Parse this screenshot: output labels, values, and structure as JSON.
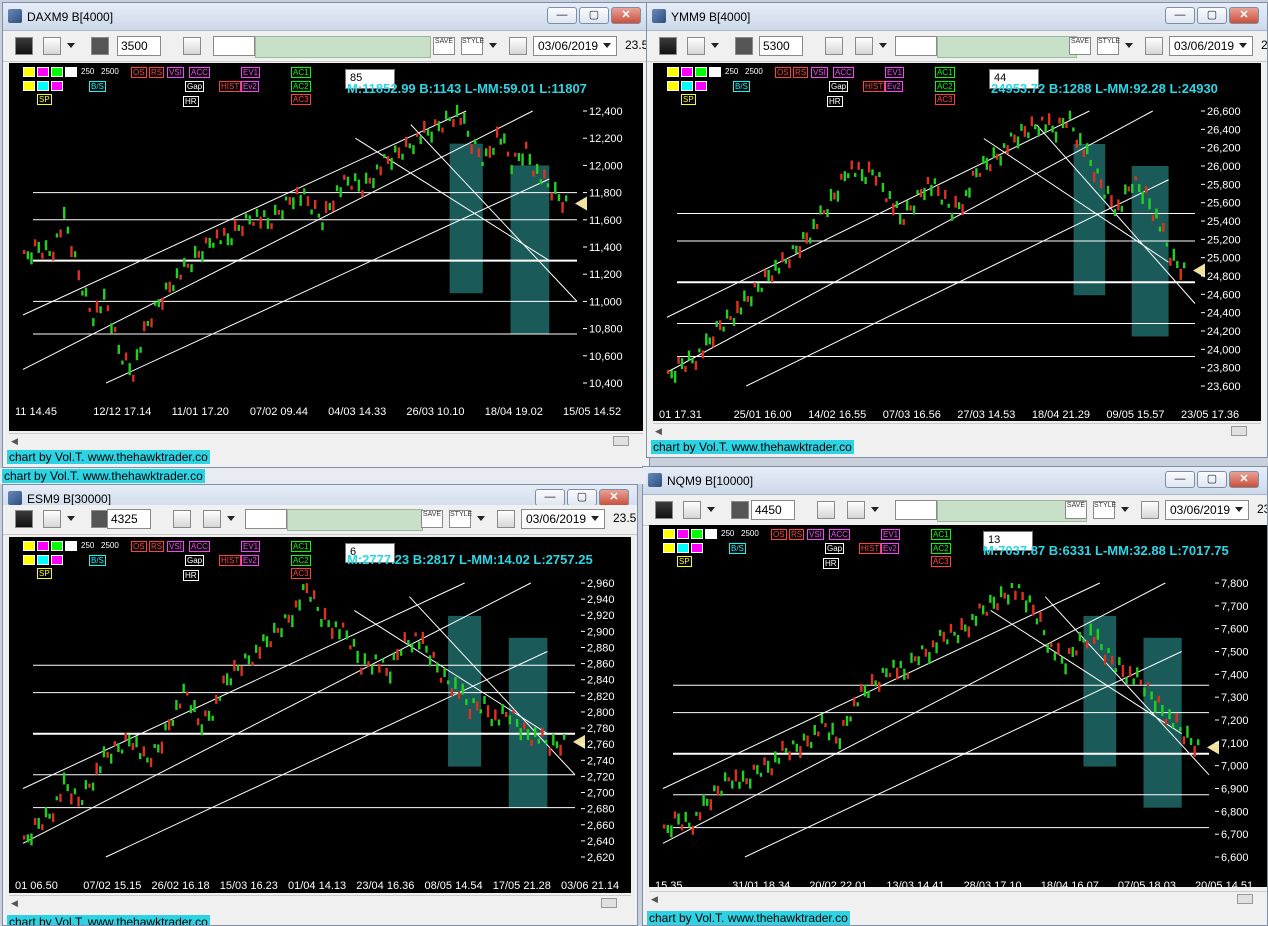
{
  "common": {
    "dd_value": "250",
    "dd_value2": "2500",
    "date": "03/06/2019",
    "clip": "23.5",
    "credit": "chart by Vol.T. www.thehawktrader.co",
    "btn_min": "—",
    "btn_max": "▢",
    "btn_close": "✕",
    "save_label": "SAVE",
    "style_label": "STYLE",
    "hr_label": "HR",
    "gap_label": "Gap",
    "hist_label": "HIST",
    "ev1_label": "EV1",
    "ev2_label": "Ev2",
    "ac1_label": "AC1",
    "ac2_label": "AC2",
    "ac3_label": "AC3",
    "x_label": "X",
    "os_label": "OS",
    "rs_label": "RS",
    "vsi_label": "VSI",
    "acc_label": "ACC",
    "bs_label": "B/S",
    "sp_label": "SP",
    "colors": {
      "bull": "#22d022",
      "bear": "#e03020",
      "teal_box": "#1a5a58",
      "stat": "#2bd7e6"
    }
  },
  "windows": [
    {
      "title": "DAXM9 B[4000]",
      "bars": "3500",
      "alert": "85",
      "stat": "M:11852.99 B:1143 L-MM:59.01 L:11807",
      "y_ticks": [
        "12,400",
        "12,200",
        "12,000",
        "11,800",
        "11,600",
        "11,400",
        "11,200",
        "11,000",
        "10,800",
        "10,600",
        "10,400"
      ],
      "x_ticks": [
        "11 14.45",
        "12/12 17.14",
        "11/01 17.20",
        "07/02 09.44",
        "04/03 14.33",
        "26/03 10.10",
        "18/04 19.02",
        "15/05 14.52"
      ]
    },
    {
      "title": "YMM9 B[4000]",
      "bars": "5300",
      "alert": "44",
      "stat": "24953.72 B:1288 L-MM:92.28 L:24930",
      "y_ticks": [
        "26,600",
        "26,400",
        "26,200",
        "26,000",
        "25,800",
        "25,600",
        "25,400",
        "25,200",
        "25,000",
        "24,800",
        "24,600",
        "24,400",
        "24,200",
        "24,000",
        "23,800",
        "23,600"
      ],
      "x_ticks": [
        "01 17.31",
        "25/01 16.00",
        "14/02 16.55",
        "07/03 16.56",
        "27/03 14.53",
        "18/04 21.29",
        "09/05 15.57",
        "23/05 17.36"
      ]
    },
    {
      "title": "ESM9 B[30000]",
      "bars": "4325",
      "alert": "6",
      "stat": "M:2777.23 B:2817 L-MM:14.02 L:2757.25",
      "y_ticks": [
        "2,960",
        "2,940",
        "2,920",
        "2,900",
        "2,880",
        "2,860",
        "2,840",
        "2,820",
        "2,800",
        "2,780",
        "2,760",
        "2,740",
        "2,720",
        "2,700",
        "2,680",
        "2,660",
        "2,640",
        "2,620"
      ],
      "x_ticks": [
        "01 06.50",
        "07/02 15.15",
        "26/02 16.18",
        "15/03 16.23",
        "01/04 14.13",
        "23/04 16.36",
        "08/05 14.54",
        "17/05 21.28",
        "03/06 21.14"
      ]
    },
    {
      "title": "NQM9 B[10000]",
      "bars": "4450",
      "alert": "13",
      "stat": "M:7037.87 B:6331 L-MM:32.88 L:7017.75",
      "y_ticks": [
        "7,800",
        "7,700",
        "7,600",
        "7,500",
        "7,400",
        "7,300",
        "7,200",
        "7,100",
        "7,000",
        "6,900",
        "6,800",
        "6,700",
        "6,600"
      ],
      "x_ticks": [
        "15.35",
        "31/01 18.34",
        "20/02 22.01",
        "13/03 14.41",
        "28/03 17.10",
        "18/04 16.07",
        "07/05 18.03",
        "20/05 14.51"
      ]
    }
  ]
}
